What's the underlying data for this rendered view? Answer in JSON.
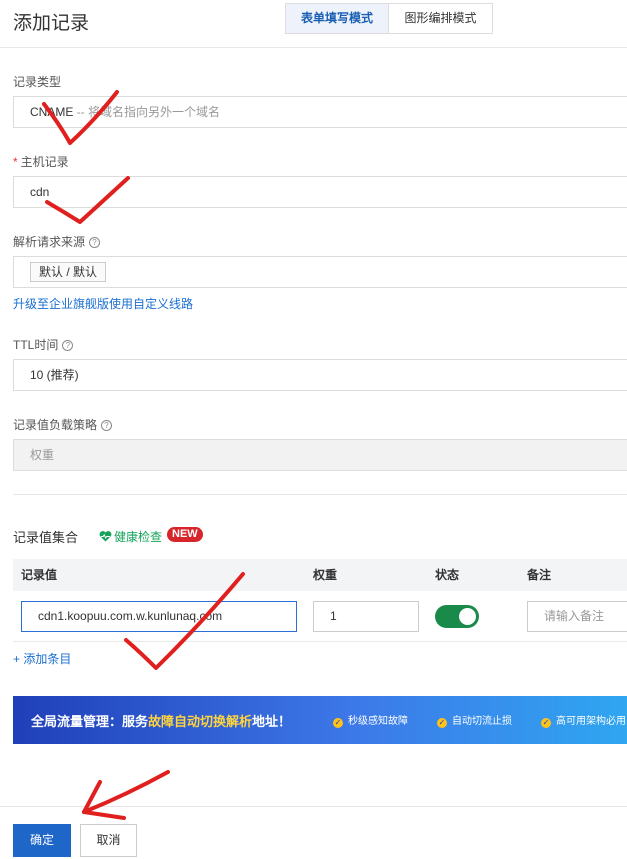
{
  "header": {
    "title": "添加记录",
    "tabs": [
      {
        "label": "表单填写模式",
        "active": true
      },
      {
        "label": "图形编排模式",
        "active": false
      }
    ]
  },
  "form": {
    "record_type": {
      "label": "记录类型",
      "value": "CNAME",
      "hint": "-- 将域名指向另外一个域名"
    },
    "host": {
      "required_mark": "*",
      "label": "主机记录",
      "value": "cdn"
    },
    "resolve_source": {
      "label": "解析请求来源",
      "value": "默认 / 默认",
      "upgrade_link": "升级至企业旗舰版使用自定义线路"
    },
    "ttl": {
      "label": "TTL时间",
      "value": "10 (推荐)"
    },
    "load_strategy": {
      "label": "记录值负载策略",
      "value": "权重"
    }
  },
  "record_set": {
    "title": "记录值集合",
    "health_check": "健康检查",
    "badge": "NEW",
    "columns": [
      "记录值",
      "权重",
      "状态",
      "备注"
    ],
    "rows": [
      {
        "value": "cdn1.koopuu.com.w.kunlunaq.com",
        "weight": "1",
        "enabled": true,
        "remark_placeholder": "请输入备注"
      }
    ],
    "add_entry": "+ 添加条目"
  },
  "banner": {
    "title_prefix": "全局流量管理：服务",
    "title_highlight": "故障自动切换解析",
    "title_suffix": "地址！",
    "features": [
      "秒级感知故障",
      "自动切流止损",
      "高可用架构必用"
    ]
  },
  "footer": {
    "confirm": "确定",
    "cancel": "取消"
  },
  "colors": {
    "accent": "#1f66c9",
    "toggle_on": "#1a8a4a",
    "health": "#15a35a",
    "badge": "#d7252c",
    "annotation": "#e0201e"
  }
}
